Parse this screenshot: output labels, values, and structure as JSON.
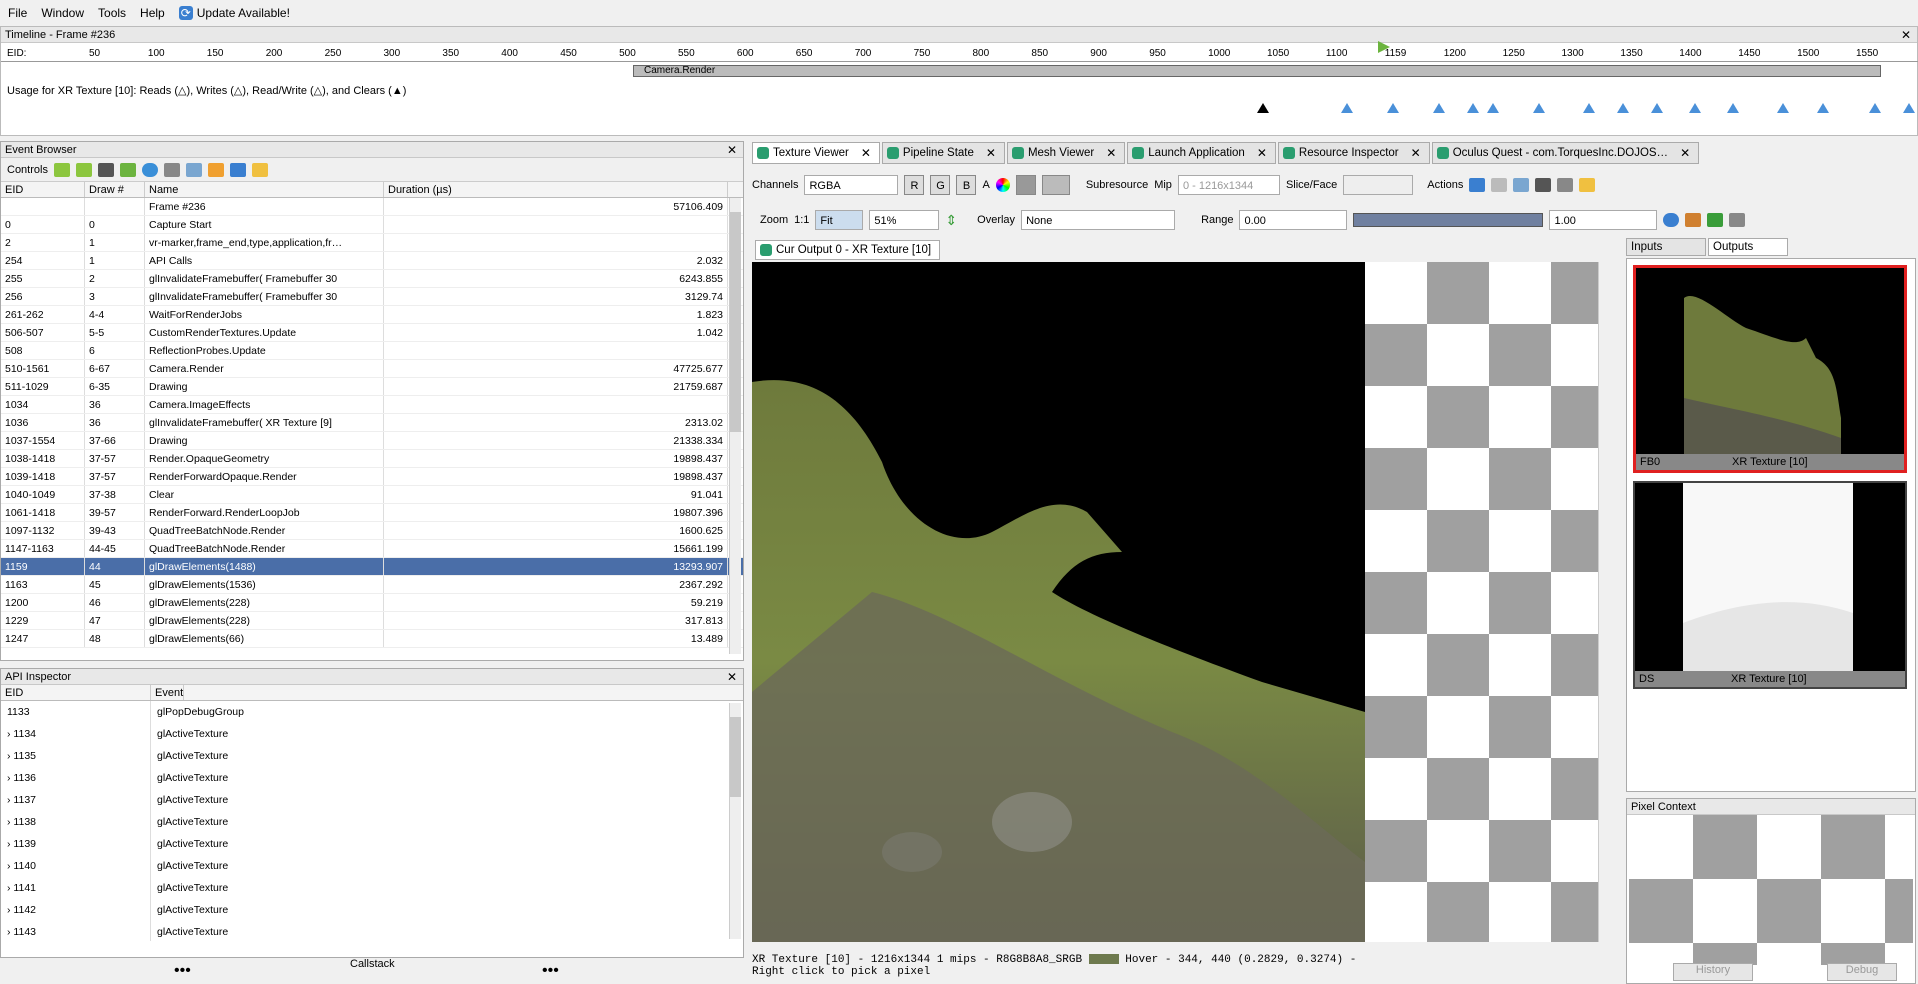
{
  "menu": {
    "file": "File",
    "window": "Window",
    "tools": "Tools",
    "help": "Help",
    "update": "Update Available!"
  },
  "timeline": {
    "title": "Timeline - Frame #236",
    "eid_label": "EID:",
    "ticks": [
      "50",
      "100",
      "150",
      "200",
      "250",
      "300",
      "350",
      "400",
      "450",
      "500",
      "550",
      "600",
      "650",
      "700",
      "750",
      "800",
      "850",
      "900",
      "950",
      "1000",
      "1050",
      "1100",
      "1159",
      "1200",
      "1250",
      "1300",
      "1350",
      "1400",
      "1450",
      "1500",
      "1550"
    ],
    "bar_label": "Camera.Render",
    "usage": "Usage for XR Texture [10]: Reads (△), Writes (△), Read/Write (△), and Clears (▲)"
  },
  "event_browser": {
    "title": "Event Browser",
    "controls_label": "Controls",
    "columns": [
      "EID",
      "Draw #",
      "Name",
      "Duration (µs)"
    ],
    "rows": [
      {
        "eid": "",
        "draw": "",
        "name": "Frame #236",
        "dur": "57106.409"
      },
      {
        "eid": "0",
        "draw": "0",
        "name": "Capture Start",
        "dur": ""
      },
      {
        "eid": "2",
        "draw": "1",
        "name": "vr-marker,frame_end,type,application,fr…",
        "dur": ""
      },
      {
        "eid": "254",
        "draw": "1",
        "name": "API Calls",
        "dur": "2.032"
      },
      {
        "eid": "255",
        "draw": "2",
        "name": "glInvalidateFramebuffer( Framebuffer 30",
        "dur": "6243.855"
      },
      {
        "eid": "256",
        "draw": "3",
        "name": "glInvalidateFramebuffer( Framebuffer 30",
        "dur": "3129.74"
      },
      {
        "eid": "261-262",
        "draw": "4-4",
        "name": "WaitForRenderJobs",
        "dur": "1.823"
      },
      {
        "eid": "506-507",
        "draw": "5-5",
        "name": "CustomRenderTextures.Update",
        "dur": "1.042"
      },
      {
        "eid": "508",
        "draw": "6",
        "name": "ReflectionProbes.Update",
        "dur": ""
      },
      {
        "eid": "510-1561",
        "draw": "6-67",
        "name": "Camera.Render",
        "dur": "47725.677"
      },
      {
        "eid": "511-1029",
        "draw": "6-35",
        "name": "Drawing",
        "dur": "21759.687"
      },
      {
        "eid": "1034",
        "draw": "36",
        "name": "Camera.ImageEffects",
        "dur": ""
      },
      {
        "eid": "1036",
        "draw": "36",
        "name": "glInvalidateFramebuffer( XR Texture [9]",
        "dur": "2313.02"
      },
      {
        "eid": "1037-1554",
        "draw": "37-66",
        "name": "Drawing",
        "dur": "21338.334"
      },
      {
        "eid": "1038-1418",
        "draw": "37-57",
        "name": "Render.OpaqueGeometry",
        "dur": "19898.437"
      },
      {
        "eid": "1039-1418",
        "draw": "37-57",
        "name": "RenderForwardOpaque.Render",
        "dur": "19898.437"
      },
      {
        "eid": "1040-1049",
        "draw": "37-38",
        "name": "Clear",
        "dur": "91.041"
      },
      {
        "eid": "1061-1418",
        "draw": "39-57",
        "name": "RenderForward.RenderLoopJob",
        "dur": "19807.396"
      },
      {
        "eid": "1097-1132",
        "draw": "39-43",
        "name": "QuadTreeBatchNode.Render",
        "dur": "1600.625"
      },
      {
        "eid": "1147-1163",
        "draw": "44-45",
        "name": "QuadTreeBatchNode.Render",
        "dur": "15661.199"
      },
      {
        "eid": "1159",
        "draw": "44",
        "name": "glDrawElements(1488)",
        "dur": "13293.907"
      },
      {
        "eid": "1163",
        "draw": "45",
        "name": "glDrawElements(1536)",
        "dur": "2367.292"
      },
      {
        "eid": "1200",
        "draw": "46",
        "name": "glDrawElements(228)",
        "dur": "59.219"
      },
      {
        "eid": "1229",
        "draw": "47",
        "name": "glDrawElements(228)",
        "dur": "317.813"
      },
      {
        "eid": "1247",
        "draw": "48",
        "name": "glDrawElements(66)",
        "dur": "13.489"
      }
    ]
  },
  "api_inspector": {
    "title": "API Inspector",
    "columns": [
      "EID",
      "Event"
    ],
    "rows": [
      {
        "eid": "1133",
        "event": "glPopDebugGroup"
      },
      {
        "eid": "1134",
        "event": "glActiveTexture"
      },
      {
        "eid": "1135",
        "event": "glActiveTexture"
      },
      {
        "eid": "1136",
        "event": "glActiveTexture"
      },
      {
        "eid": "1137",
        "event": "glActiveTexture"
      },
      {
        "eid": "1138",
        "event": "glActiveTexture"
      },
      {
        "eid": "1139",
        "event": "glActiveTexture"
      },
      {
        "eid": "1140",
        "event": "glActiveTexture"
      },
      {
        "eid": "1141",
        "event": "glActiveTexture"
      },
      {
        "eid": "1142",
        "event": "glActiveTexture"
      },
      {
        "eid": "1143",
        "event": "glActiveTexture"
      }
    ],
    "callstack": "Callstack"
  },
  "tabs": [
    "Texture Viewer",
    "Pipeline State",
    "Mesh Viewer",
    "Launch Application",
    "Resource Inspector",
    "Oculus Quest - com.TorquesInc.DOJOS…"
  ],
  "texture_viewer": {
    "channels_label": "Channels",
    "channels_value": "RGBA",
    "r": "R",
    "g": "G",
    "b": "B",
    "a": "A",
    "subresource_label": "Subresource",
    "mip_label": "Mip",
    "mip_value": "0 - 1216x1344",
    "slice_label": "Slice/Face",
    "actions_label": "Actions",
    "zoom_label": "Zoom",
    "zoom_1to1": "1:1",
    "fit_label": "Fit",
    "zoom_value": "51%",
    "overlay_label": "Overlay",
    "overlay_value": "None",
    "range_label": "Range",
    "range_min": "0.00",
    "range_max": "1.00",
    "output_tab": "Cur Output 0 - XR Texture [10]",
    "status": "XR Texture [10] - 1216x1344 1 mips - R8G8B8A8_SRGB",
    "hover": "Hover -   344,  440 (0.2829, 0.3274)  -",
    "hint": "Right click to pick a pixel"
  },
  "thumbnails": {
    "inputs_tab": "Inputs",
    "outputs_tab": "Outputs",
    "items": [
      {
        "slot": "FB0",
        "name": "XR Texture [10]"
      },
      {
        "slot": "DS",
        "name": "XR Texture [10]"
      }
    ]
  },
  "pixel_context": {
    "title": "Pixel Context",
    "history": "History",
    "debug": "Debug"
  }
}
